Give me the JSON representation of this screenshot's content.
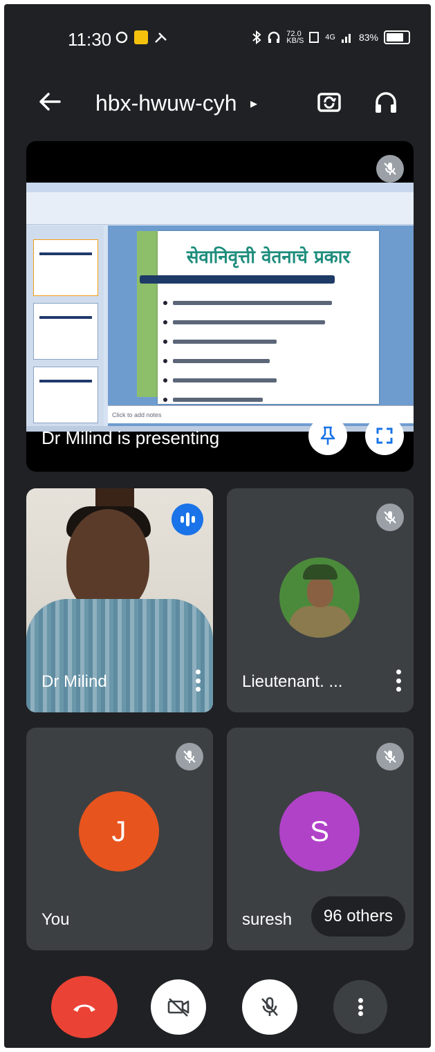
{
  "status_bar": {
    "time": "11:30",
    "network_speed": "72.0\nKB/S",
    "signal_label": "4G",
    "battery": "83%"
  },
  "top_bar": {
    "meeting_code": "hbx-hwuw-cyh",
    "caret": "▸"
  },
  "presentation": {
    "presenter_label": "Dr Milind is presenting",
    "slide_title": "सेवानिवृत्ती वेतनाचे प्रकार",
    "slide_bullets_count": 6,
    "notes_placeholder": "Click to add notes"
  },
  "participants": [
    {
      "name": "Dr Milind",
      "state": "speaking"
    },
    {
      "name": "Lieutenant. ...",
      "state": "muted"
    },
    {
      "name": "You",
      "initial": "J",
      "avatar_color": "#e8541e",
      "state": "muted"
    },
    {
      "name": "suresh",
      "initial": "S",
      "avatar_color": "#b042c8",
      "state": "muted"
    }
  ],
  "others": "96 others",
  "controls": {
    "end_call": "end-call",
    "camera": "camera-off",
    "mic": "mic-off",
    "more": "more-options"
  },
  "colors": {
    "background": "#202124",
    "tile": "#3c4043",
    "end_call": "#ea4335",
    "speaking": "#1a73e8"
  }
}
